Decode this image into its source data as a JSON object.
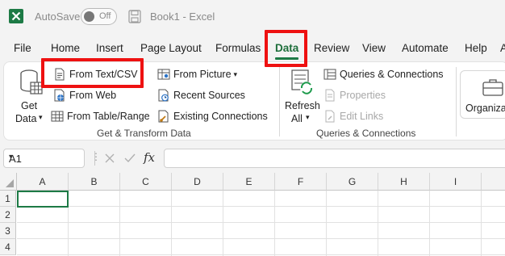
{
  "title_bar": {
    "autosave_label": "AutoSave",
    "autosave_state": "Off",
    "document_title": "Book1  -  Excel"
  },
  "tabs": [
    {
      "label": "File"
    },
    {
      "label": "Home"
    },
    {
      "label": "Insert"
    },
    {
      "label": "Page Layout"
    },
    {
      "label": "Formulas"
    },
    {
      "label": "Data",
      "active": true
    },
    {
      "label": "Review"
    },
    {
      "label": "View"
    },
    {
      "label": "Automate"
    },
    {
      "label": "Help"
    },
    {
      "label": "A"
    }
  ],
  "ribbon": {
    "get_data": {
      "line1": "Get",
      "line2": "Data"
    },
    "get_transform": {
      "from_text_csv": "From Text/CSV",
      "from_web": "From Web",
      "from_table_range": "From Table/Range",
      "from_picture": "From Picture",
      "recent_sources": "Recent Sources",
      "existing_connections": "Existing Connections",
      "group_label": "Get & Transform Data"
    },
    "queries": {
      "refresh_line1": "Refresh",
      "refresh_line2": "All",
      "queries_connections": "Queries & Connections",
      "properties": "Properties",
      "edit_links": "Edit Links",
      "group_label": "Queries & Connections"
    },
    "organization": {
      "label": "Organizat"
    }
  },
  "formula_bar": {
    "name_box": "A1",
    "fx": "fx",
    "value": ""
  },
  "grid": {
    "columns": [
      "A",
      "B",
      "C",
      "D",
      "E",
      "F",
      "G",
      "H",
      "I"
    ],
    "rows": [
      "1",
      "2",
      "3",
      "4"
    ]
  },
  "colors": {
    "accent": "#1d7a45",
    "highlight": "#ee1111"
  }
}
